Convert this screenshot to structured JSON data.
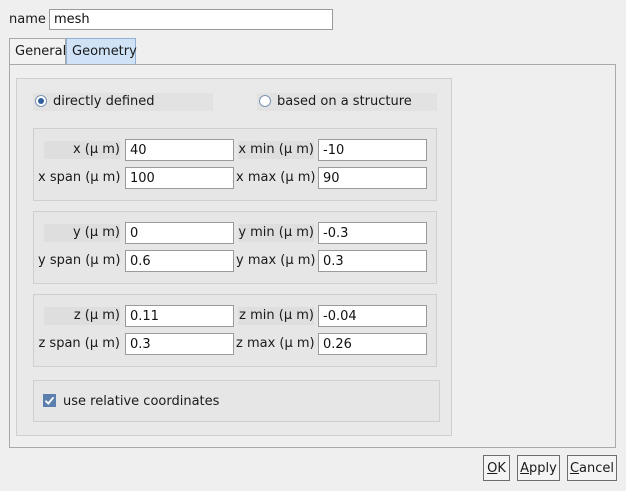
{
  "name": {
    "label": "name",
    "value": "mesh"
  },
  "tabs": [
    {
      "label": "General"
    },
    {
      "label": "Geometry"
    }
  ],
  "definition": {
    "option1": "directly defined",
    "option2": "based on a structure",
    "selected": "directly defined"
  },
  "x": {
    "center_label": "x (μ m)",
    "center_value": "40",
    "min_label": "x min (μ m)",
    "min_value": "-10",
    "span_label": "x span (μ m)",
    "span_value": "100",
    "max_label": "x max (μ m)",
    "max_value": "90"
  },
  "y": {
    "center_label": "y (μ m)",
    "center_value": "0",
    "min_label": "y min (μ m)",
    "min_value": "-0.3",
    "span_label": "y span (μ m)",
    "span_value": "0.6",
    "max_label": "y max (μ m)",
    "max_value": "0.3"
  },
  "z": {
    "center_label": "z (μ m)",
    "center_value": "0.11",
    "min_label": "z min (μ m)",
    "min_value": "-0.04",
    "span_label": "z span (μ m)",
    "span_value": "0.3",
    "max_label": "z max (μ m)",
    "max_value": "0.26"
  },
  "relative": {
    "label": "use relative coordinates",
    "checked": true
  },
  "buttons": {
    "ok_mn": "O",
    "ok_rest": "K",
    "apply_mn": "A",
    "apply_rest": "pply",
    "cancel_mn": "C",
    "cancel_rest": "ancel"
  },
  "colors": {
    "accent": "#2f5fa0",
    "tab_active": "#cfe2f6",
    "checkbox": "#5d7fae"
  },
  "icons": {
    "check": "check-icon",
    "radio_selected": "radio-selected-icon",
    "radio_unselected": "radio-unselected-icon"
  }
}
